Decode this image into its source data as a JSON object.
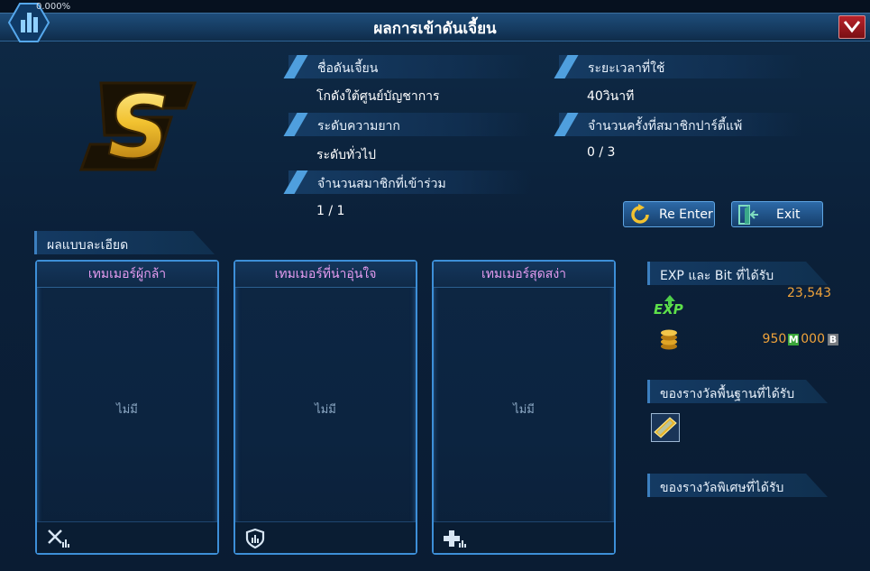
{
  "window": {
    "title": "ผลการเข้าดันเจี้ยน",
    "percent": "0.000%"
  },
  "rank": "S",
  "info": {
    "dungeon_name_label": "ชื่อดันเจี้ยน",
    "dungeon_name_value": "โกดังใต้ศูนย์บัญชาการ",
    "time_label": "ระยะเวลาที่ใช้",
    "time_value": "40วินาที",
    "difficulty_label": "ระดับความยาก",
    "difficulty_value": "ระดับทั่วไป",
    "party_deaths_label": "จำนวนครั้งที่สมาชิกปาร์ตี้แพ้",
    "party_deaths_value": "0 / 3",
    "members_label": "จำนวนสมาชิกที่เข้าร่วม",
    "members_value": "1 / 1"
  },
  "buttons": {
    "reenter": "Re Enter",
    "exit": "Exit"
  },
  "details": {
    "header": "ผลแบบละเอียด",
    "panels": [
      {
        "title": "เทมเมอร์ผู้กล้า",
        "value": "ไม่มี",
        "icon": "crossed-swords-icon"
      },
      {
        "title": "เทมเมอร์ที่น่าอุ่นใจ",
        "value": "ไม่มี",
        "icon": "shield-icon"
      },
      {
        "title": "เทมเมอร์สุดสง่า",
        "value": "ไม่มี",
        "icon": "heal-cross-icon"
      }
    ]
  },
  "rewards": {
    "exp_bit_header": "EXP และ Bit ที่ได้รับ",
    "exp_icon_text": "EXP",
    "exp_value": "23,543",
    "bit_mega": "950",
    "bit_mega_unit": "M",
    "bit_base": "000",
    "bit_base_unit": "B",
    "basic_header": "ของรางวัลพื้นฐานที่ได้รับ",
    "special_header": "ของรางวัลพิเศษที่ได้รับ"
  },
  "colors": {
    "accent": "#4f9fde",
    "panel_title": "#e59cf0",
    "exp_value": "#f0a33a",
    "bit_value": "#f0a33a",
    "rank_gold": "#f2c230"
  }
}
